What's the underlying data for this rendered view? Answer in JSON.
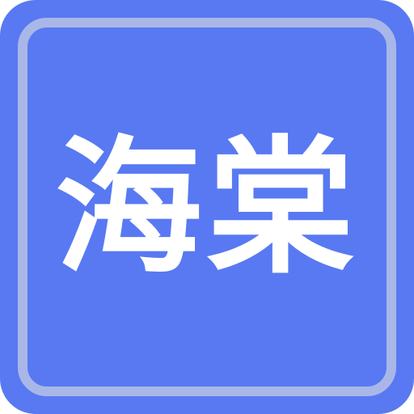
{
  "app_icon": {
    "label": "海棠",
    "colors": {
      "background": "#5879f2",
      "frame": "#a9b7e8",
      "text": "#ffffff"
    }
  }
}
